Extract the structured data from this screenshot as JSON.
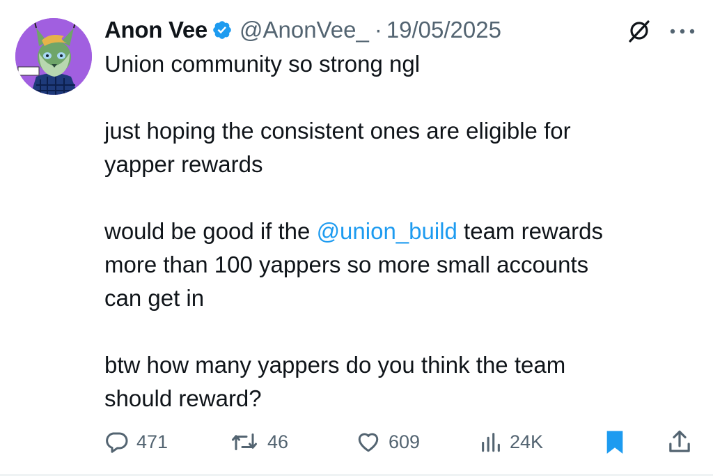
{
  "tweet": {
    "author_name": "Anon Vee",
    "handle": "@AnonVee_",
    "separator": "·",
    "date": "19/05/2025",
    "paragraphs": {
      "p1": "Union community so strong ngl",
      "p2_line1": "just hoping the consistent ones are eligible for",
      "p2_line2": "yapper rewards",
      "p3_before": "would be good if the ",
      "p3_mention": "@union_build",
      "p3_after": " team rewards",
      "p3_line2": "more than 100 yappers so more small accounts",
      "p3_line3": "can get in",
      "p4_line1": "btw how many yappers do you think the team",
      "p4_line2": "should reward?"
    }
  },
  "actions": {
    "replies": "471",
    "reposts": "46",
    "likes": "609",
    "views": "24K"
  },
  "colors": {
    "text": "#0f1419",
    "secondary": "#536471",
    "link": "#1d9bf0",
    "verified": "#1d9bf0",
    "bookmark_active": "#1d9bf0",
    "avatar_bg": "#a15fe0"
  },
  "icons": {
    "verified": "verified-badge-icon",
    "grok": "grok-icon",
    "more": "more-options-icon",
    "reply": "reply-icon",
    "repost": "repost-icon",
    "like": "like-icon",
    "views": "views-icon",
    "bookmark": "bookmark-icon",
    "share": "share-icon"
  }
}
